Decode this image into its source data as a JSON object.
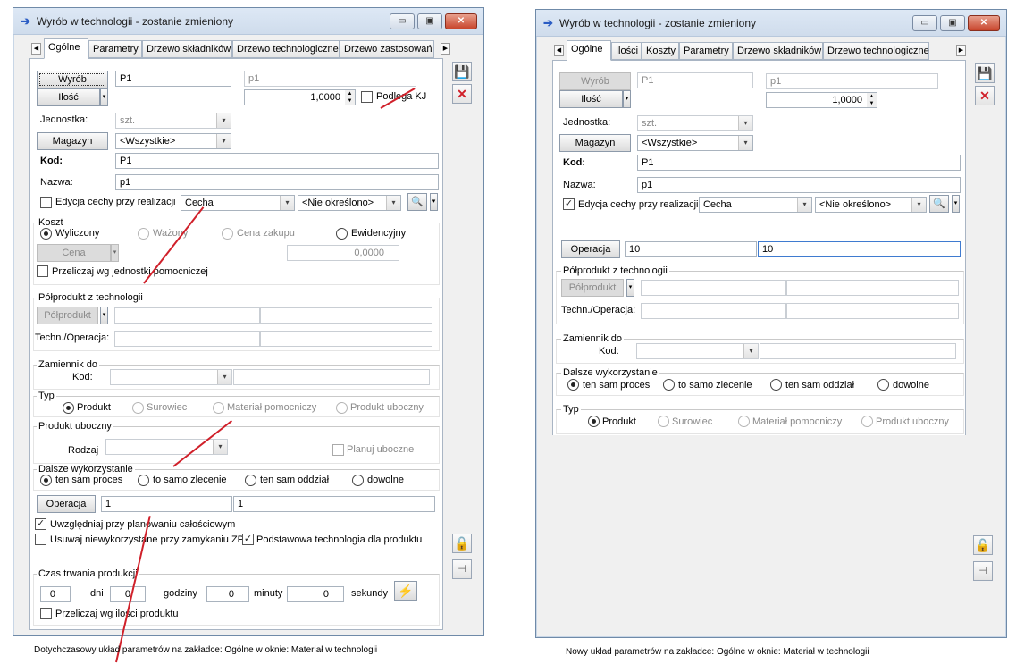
{
  "old_window": {
    "title": "Wyrób w technologii - zostanie zmieniony",
    "tabs": [
      "Ogólne",
      "Parametry",
      "Drzewo składników",
      "Drzewo technologiczne",
      "Drzewo zastosowań"
    ],
    "wyrob_button": "Wyrób",
    "wyrob_code": "P1",
    "wyrob_name": "p1",
    "ilosc_button": "Ilość",
    "ilosc_value": "1,0000",
    "podlega_kj": "Podlega KJ",
    "jednostka_label": "Jednostka:",
    "jednostka_value": "szt.",
    "magazyn_button": "Magazyn",
    "magazyn_value": "<Wszystkie>",
    "kod_label": "Kod:",
    "kod_value": "P1",
    "nazwa_label": "Nazwa:",
    "nazwa_value": "p1",
    "edycja_cechy": "Edycja cechy przy realizacji",
    "cecha_value": "Cecha",
    "nie_okreslono": "<Nie określono>",
    "koszt_group": "Koszt",
    "koszt_radios": [
      "Wyliczony",
      "Ważony",
      "Cena zakupu",
      "Ewidencyjny"
    ],
    "cena_button": "Cena",
    "cena_value": "0,0000",
    "przeliczaj_jedn": "Przeliczaj wg jednostki pomocniczej",
    "polprodukt_group": "Półprodukt z technologii",
    "polprodukt_button": "Półprodukt",
    "techn_oper_label": "Techn./Operacja:",
    "zamiennik_group": "Zamiennik do",
    "zamiennik_kod": "Kod:",
    "typ_group": "Typ",
    "typ_radios": [
      "Produkt",
      "Surowiec",
      "Materiał pomocniczy",
      "Produkt uboczny"
    ],
    "produkt_uboczny_group": "Produkt uboczny",
    "rodzaj_label": "Rodzaj",
    "planuj_uboczne": "Planuj uboczne",
    "dalsze_group": "Dalsze wykorzystanie",
    "dalsze_radios": [
      "ten sam proces",
      "to samo zlecenie",
      "ten sam oddział",
      "dowolne"
    ],
    "operacja_button": "Operacja",
    "operacja_value1": "1",
    "operacja_value2": "1",
    "uwzgledniaj": "Uwzględniaj przy planowaniu całościowym",
    "usuwaj": "Usuwaj niewykorzystane przy zamykaniu ZP",
    "podstawowa": "Podstawowa technologia dla produktu",
    "czas_group": "Czas trwania produkcji",
    "czas_fields": [
      {
        "value": "0",
        "unit": "dni"
      },
      {
        "value": "0",
        "unit": "godziny"
      },
      {
        "value": "0",
        "unit": "minuty"
      },
      {
        "value": "0",
        "unit": "sekundy"
      }
    ],
    "przeliczaj_ilosci": "Przeliczaj wg ilości produktu"
  },
  "new_window": {
    "title": "Wyrób w technologii - zostanie zmieniony",
    "tabs": [
      "Ogólne",
      "Ilości",
      "Koszty",
      "Parametry",
      "Drzewo składników",
      "Drzewo technologiczne"
    ],
    "wyrob_button": "Wyrób",
    "wyrob_code": "P1",
    "wyrob_name": "p1",
    "ilosc_button": "Ilość",
    "ilosc_value": "1,0000",
    "jednostka_label": "Jednostka:",
    "jednostka_value": "szt.",
    "magazyn_button": "Magazyn",
    "magazyn_value": "<Wszystkie>",
    "kod_label": "Kod:",
    "kod_value": "P1",
    "nazwa_label": "Nazwa:",
    "nazwa_value": "p1",
    "edycja_cechy": "Edycja cechy przy realizacji",
    "cecha_value": "Cecha",
    "nie_okreslono": "<Nie określono>",
    "operacja_button": "Operacja",
    "operacja_value1": "10",
    "operacja_value2": "10",
    "polprodukt_group": "Półprodukt z technologii",
    "polprodukt_button": "Półprodukt",
    "techn_oper_label": "Techn./Operacja:",
    "zamiennik_group": "Zamiennik do",
    "zamiennik_kod": "Kod:",
    "dalsze_group": "Dalsze wykorzystanie",
    "dalsze_radios": [
      "ten sam proces",
      "to samo zlecenie",
      "ten sam oddział",
      "dowolne"
    ],
    "typ_group": "Typ",
    "typ_radios": [
      "Produkt",
      "Surowiec",
      "Materiał pomocniczy",
      "Produkt uboczny"
    ]
  },
  "captions": {
    "old": "Dotychczasowy układ parametrów na zakładce: Ogólne w oknie: Materiał w technologii",
    "new": "Nowy układ parametrów na zakładce: Ogólne w oknie: Materiał w technologii"
  },
  "icons": [
    "arrow-right-icon",
    "minimize-icon",
    "maximize-icon",
    "close-icon",
    "save-icon",
    "cancel-x-icon",
    "lock-icon",
    "pin-icon",
    "magnifier-icon",
    "lightning-icon",
    "chevron-down-icon",
    "spin-icon",
    "tab-scroll-left-icon",
    "tab-scroll-right-icon"
  ],
  "colors": {
    "accent_red": "#d0202a",
    "save_blue": "#3a6fc4",
    "lightning_orange": "#f0a020"
  }
}
